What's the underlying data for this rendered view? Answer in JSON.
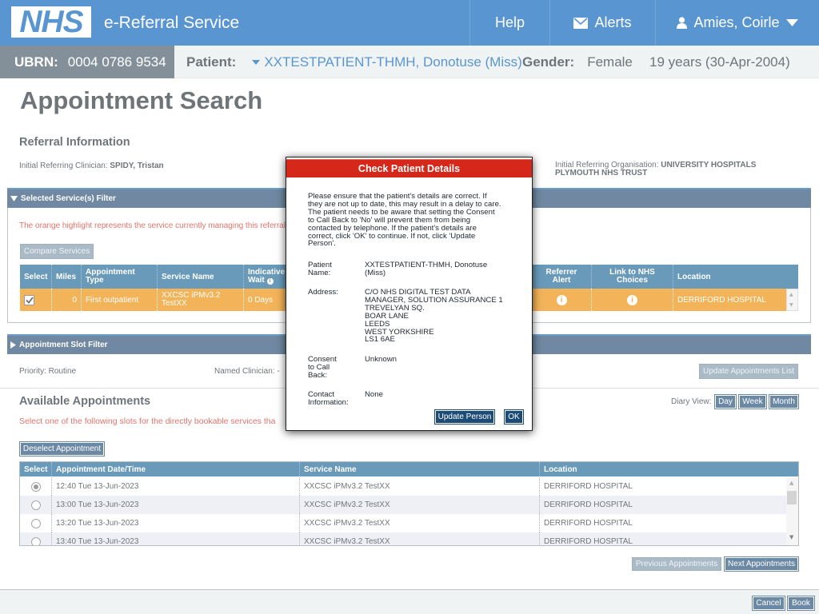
{
  "header": {
    "logo": "NHS",
    "service": "e-Referral Service",
    "help": "Help",
    "alerts": "Alerts",
    "user": "Amies, Coirle"
  },
  "banner": {
    "ubrn_label": "UBRN:",
    "ubrn": "0004 0786 9534",
    "patient_label": "Patient:",
    "patient": "XXTESTPATIENT-THMH, Donotuse (Miss)",
    "gender_label": "Gender:",
    "gender": "Female",
    "age": "19 years (30-Apr-2004)"
  },
  "page": {
    "title": "Appointment Search",
    "referral_info": "Referral Information",
    "clinician_label": "Initial Referring Clinician:",
    "clinician": "SPIDY, Tristan",
    "org_label": "Initial Referring Organisation:",
    "org_line1": "UNIVERSITY HOSPITALS",
    "org_line2": "PLYMOUTH NHS TRUST"
  },
  "service_filter": {
    "title": "Selected Service(s) Filter",
    "note": "The orange highlight represents the service currently managing this referral",
    "compare_button": "Compare Services",
    "columns": {
      "select": "Select",
      "miles": "Miles",
      "appt_type_1": "Appointment",
      "appt_type_2": "Type",
      "service_name": "Service Name",
      "wait_1": "Indicative",
      "wait_2": "Wait",
      "referrer_1": "Referrer",
      "referrer_2": "Alert",
      "nhs_1": "Link to NHS",
      "nhs_2": "Choices",
      "location": "Location"
    },
    "row": {
      "miles": "0",
      "appt_type": "First outpatient",
      "service_1": "XXCSC iPMv3.2",
      "service_2": "TestXX",
      "wait": "0 Days",
      "location": "DERRIFORD HOSPITAL"
    }
  },
  "slot_filter": {
    "title": "Appointment Slot Filter",
    "priority": "Priority: Routine",
    "named_clinician": "Named Clinician: -",
    "update_button": "Update Appointments List"
  },
  "available": {
    "title": "Available Appointments",
    "note": "Select one of the following slots for the directly bookable services tha",
    "diary_label": "Diary View:",
    "day": "Day",
    "week": "Week",
    "month": "Month",
    "deselect_button": "Deselect Appointment",
    "columns": {
      "select": "Select",
      "datetime": "Appointment Date/Time",
      "service": "Service Name",
      "location": "Location"
    },
    "rows": [
      {
        "datetime": "12:40 Tue 13-Jun-2023",
        "service": "XXCSC iPMv3.2 TestXX",
        "location": "DERRIFORD HOSPITAL"
      },
      {
        "datetime": "13:00 Tue 13-Jun-2023",
        "service": "XXCSC iPMv3.2 TestXX",
        "location": "DERRIFORD HOSPITAL"
      },
      {
        "datetime": "13:20 Tue 13-Jun-2023",
        "service": "XXCSC iPMv3.2 TestXX",
        "location": "DERRIFORD HOSPITAL"
      },
      {
        "datetime": "13:40 Tue 13-Jun-2023",
        "service": "XXCSC iPMv3.2 TestXX",
        "location": "DERRIFORD HOSPITAL"
      }
    ],
    "prev_button": "Previous Appointments",
    "next_button": "Next Appointments"
  },
  "footer": {
    "cancel": "Cancel",
    "book": "Book"
  },
  "modal": {
    "title": "Check Patient Details",
    "intro": [
      "Please ensure that the patient's details are correct. If",
      "they are not up to date, this may result in a delay to care.",
      "The patient needs to be aware that setting the Consent",
      "to Call Back to 'No' will prevent them from being",
      "contacted by telephone. If the patient's details are",
      "correct, click 'OK' to continue. If not, click 'Update",
      "Person'."
    ],
    "name_label_1": "Patient",
    "name_label_2": "Name:",
    "name_1": "XXTESTPATIENT-THMH, Donotuse",
    "name_2": "(Miss)",
    "address_label": "Address:",
    "address": [
      "C/O NHS DIGITAL TEST DATA",
      "MANAGER, SOLUTION ASSURANCE 1",
      "TREVELYAN SQ.",
      "BOAR LANE",
      "LEEDS",
      "WEST YORKSHIRE",
      "LS1 6AE"
    ],
    "consent_label": [
      "Consent",
      "to Call",
      "Back:"
    ],
    "consent": "Unknown",
    "contact_label": [
      "Contact",
      "Information:"
    ],
    "contact": "None",
    "update_button": "Update Person",
    "ok_button": "OK"
  }
}
